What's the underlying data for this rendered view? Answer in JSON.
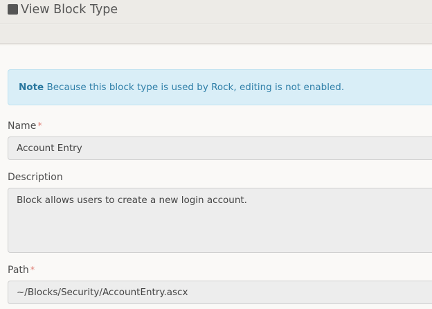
{
  "header": {
    "title": "View Block Type",
    "icon": "square-icon"
  },
  "alert": {
    "strong": "Note",
    "message": "Because this block type is used by Rock, editing is not enabled."
  },
  "fields": {
    "name": {
      "label": "Name",
      "required_marker": "*",
      "value": "Account Entry"
    },
    "description": {
      "label": "Description",
      "value": "Block allows users to create a new login account."
    },
    "path": {
      "label": "Path",
      "required_marker": "*",
      "value": "~/Blocks/Security/AccountEntry.ascx"
    }
  },
  "colors": {
    "alert_bg": "#d9eef7",
    "alert_text": "#2f7fa8",
    "required": "#e0837a",
    "input_bg": "#ededed"
  }
}
